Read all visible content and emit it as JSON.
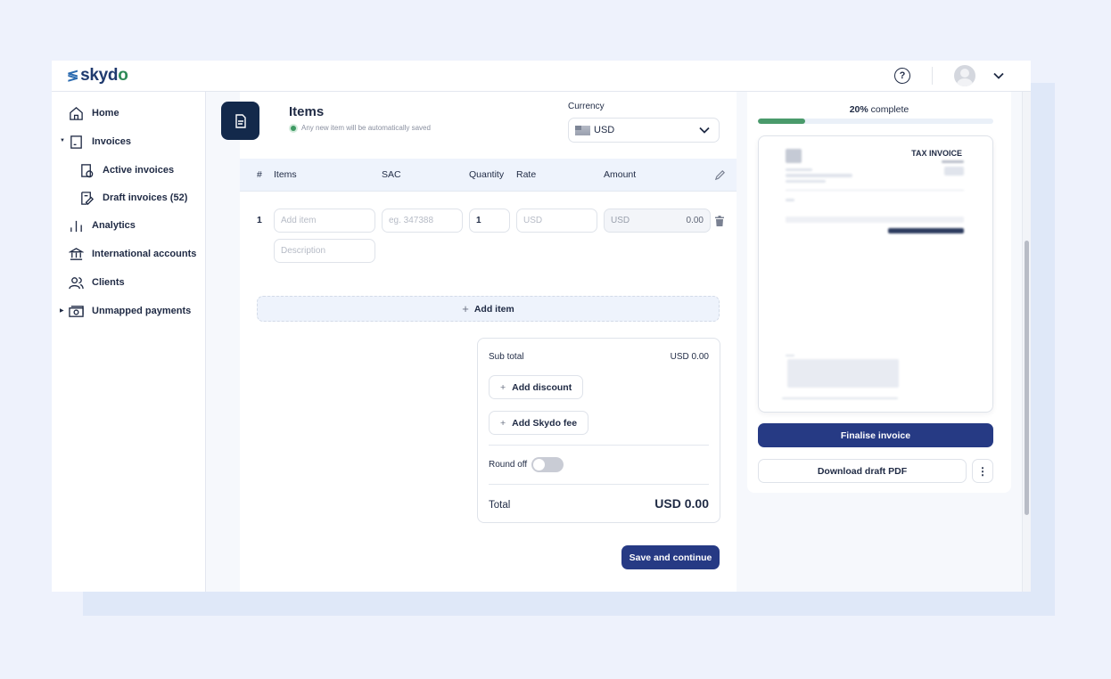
{
  "brand": {
    "name": "skydo",
    "logo_mark": "≶"
  },
  "header": {
    "help_icon": "?",
    "profile_icon": "avatar",
    "profile_menu_icon": "chevron-down"
  },
  "sidebar": {
    "items": [
      {
        "label": "Home",
        "icon": "home-icon"
      },
      {
        "label": "Invoices",
        "icon": "invoice-icon",
        "expanded": true
      },
      {
        "label": "Active invoices",
        "icon": "active-invoice-icon"
      },
      {
        "label": "Draft invoices (52)",
        "icon": "draft-invoice-icon"
      },
      {
        "label": "Analytics",
        "icon": "analytics-icon"
      },
      {
        "label": "International accounts",
        "icon": "bank-icon"
      },
      {
        "label": "Clients",
        "icon": "clients-icon"
      },
      {
        "label": "Unmapped payments",
        "icon": "payments-icon"
      }
    ]
  },
  "items_section": {
    "title": "Items",
    "autosave_note": "Any new item will be automatically saved",
    "currency_label": "Currency",
    "currency_value": "USD",
    "columns": [
      "#",
      "Items",
      "SAC",
      "Quantity",
      "Rate",
      "Amount"
    ],
    "rows": [
      {
        "number": "1",
        "item_placeholder": "Add item",
        "sac_placeholder": "eg. 347388",
        "quantity": "1",
        "rate_placeholder": "USD",
        "amount_currency": "USD",
        "amount_value": "0.00",
        "description_placeholder": "Description"
      }
    ],
    "add_item_label": "Add item"
  },
  "summary": {
    "subtotal_label": "Sub total",
    "subtotal_value": "USD 0.00",
    "add_discount_label": "Add discount",
    "add_fee_label": "Add Skydo fee",
    "round_off_label": "Round off",
    "round_off_enabled": false,
    "total_label": "Total",
    "total_value": "USD 0.00"
  },
  "save_button_label": "Save and continue",
  "progress": {
    "percent_label": "20%",
    "suffix": "complete",
    "value": 0.2
  },
  "preview": {
    "title": "TAX INVOICE"
  },
  "finalise_label": "Finalise invoice",
  "download_label": "Download draft PDF",
  "more_label": "⋮",
  "colors": {
    "primary": "#263a84",
    "dark_badge": "#13294b",
    "progress": "#4a9a6b",
    "brand_green": "#2e8a57"
  }
}
